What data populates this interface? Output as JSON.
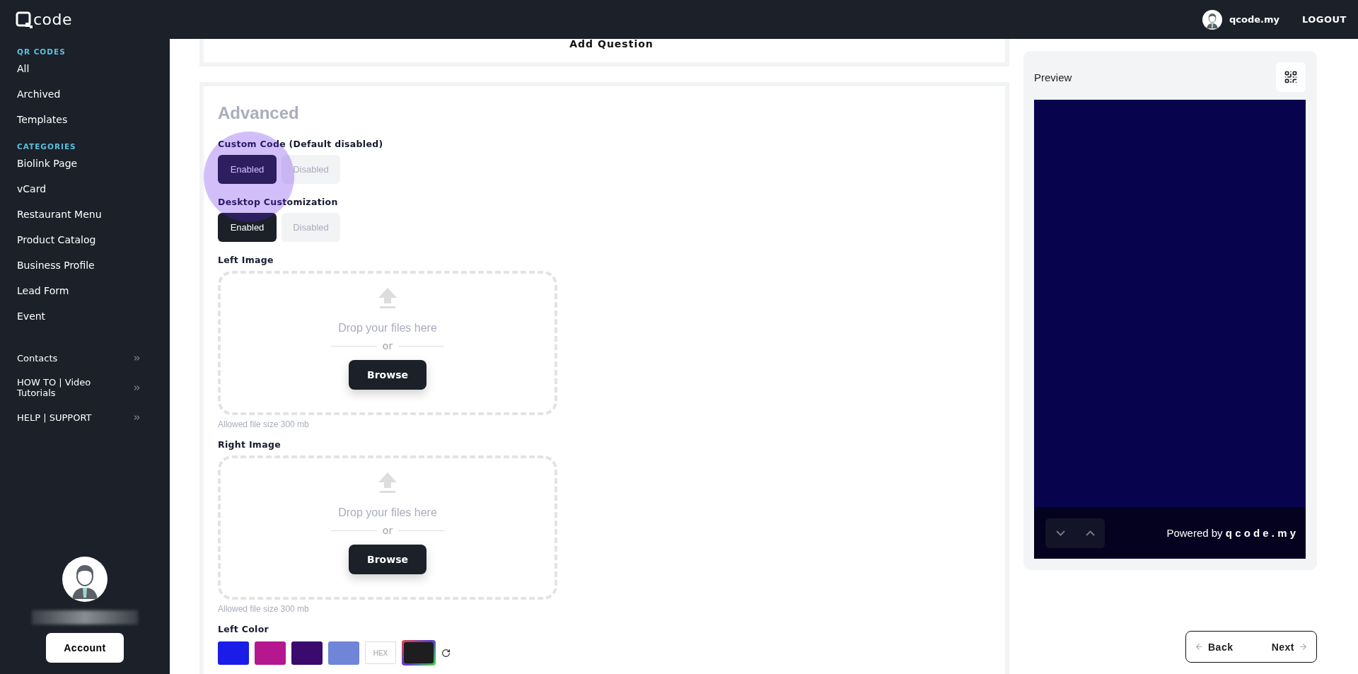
{
  "topbar": {
    "logo": "code",
    "user": "qcode.my",
    "logout": "LOGOUT"
  },
  "sidebar": {
    "sections": [
      {
        "heading": "QR CODES",
        "items": [
          {
            "label": "All"
          },
          {
            "label": "Archived"
          },
          {
            "label": "Templates"
          }
        ]
      },
      {
        "heading": "CATEGORIES",
        "items": [
          {
            "label": "Biolink Page"
          },
          {
            "label": "vCard"
          },
          {
            "label": "Restaurant Menu"
          },
          {
            "label": "Product Catalog"
          },
          {
            "label": "Business Profile"
          },
          {
            "label": "Lead Form"
          },
          {
            "label": "Event"
          }
        ]
      }
    ],
    "expandable": [
      {
        "label": "Contacts"
      },
      {
        "label": "HOW TO | Video Tutorials"
      },
      {
        "label": "HELP | SUPPORT"
      }
    ],
    "account_button": "Account"
  },
  "add_question": "Add Question",
  "advanced": {
    "title": "Advanced",
    "toggles": [
      {
        "label": "Custom Code (Default disabled)",
        "options": [
          {
            "label": "Enabled",
            "selected": true
          },
          {
            "label": "Disabled",
            "selected": false
          }
        ]
      },
      {
        "label": "Desktop Customization",
        "options": [
          {
            "label": "Enabled",
            "selected": true
          },
          {
            "label": "Disabled",
            "selected": false
          }
        ]
      }
    ],
    "uploads": [
      {
        "label": "Left Image",
        "drop_text": "Drop your files here",
        "or": "or",
        "button": "Browse",
        "note": "Allowed file size  300 mb"
      },
      {
        "label": "Right Image",
        "drop_text": "Drop your files here",
        "or": "or",
        "button": "Browse",
        "note": "Allowed file size  300 mb"
      }
    ],
    "left_color": {
      "label": "Left Color",
      "swatches": [
        {
          "kind": "swatch",
          "color": "#1a1de8"
        },
        {
          "kind": "swatch",
          "color": "#b5178e"
        },
        {
          "kind": "swatch",
          "color": "#3a0a6e"
        },
        {
          "kind": "swatch",
          "color": "#6f85d8"
        },
        {
          "kind": "hex",
          "text": "HEX"
        },
        {
          "kind": "picker",
          "color": "#1e1e1e"
        }
      ]
    }
  },
  "preview": {
    "title": "Preview",
    "footer": "Powered by **q c o d e . m y**"
  },
  "nav": {
    "back": "Back",
    "next": "Next"
  }
}
